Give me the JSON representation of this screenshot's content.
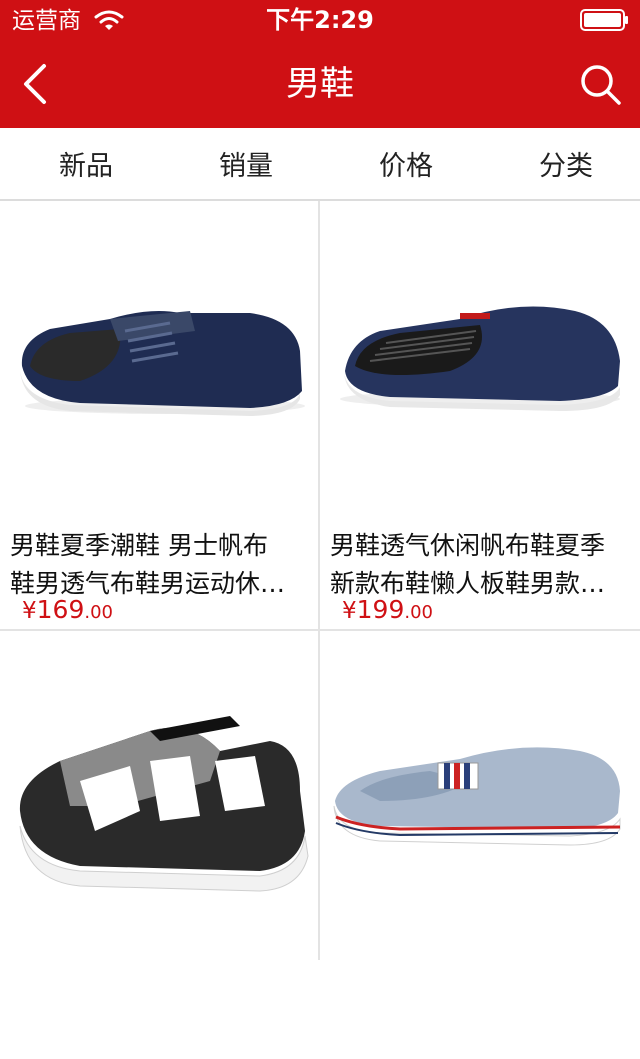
{
  "status_bar": {
    "carrier": "运营商",
    "time": "下午2:29",
    "wifi_icon": "wifi-icon",
    "battery_icon": "battery-icon"
  },
  "nav": {
    "title": "男鞋",
    "back_icon": "chevron-left-icon",
    "search_icon": "search-icon",
    "background": "#cf1014"
  },
  "filters": [
    "新品",
    "销量",
    "价格",
    "分类"
  ],
  "products": [
    {
      "name_line1": "男鞋夏季潮鞋 男士帆布",
      "name_line2": "鞋男透气布鞋男运动休…",
      "price_currency": "¥",
      "price_int": "169",
      "price_dec": ".00"
    },
    {
      "name_line1": "男鞋透气休闲帆布鞋夏季",
      "name_line2": "新款布鞋懒人板鞋男款…",
      "price_currency": "¥",
      "price_int": "199",
      "price_dec": ".00"
    },
    {
      "name_line1": "",
      "name_line2": "",
      "price_currency": "",
      "price_int": "",
      "price_dec": ""
    },
    {
      "name_line1": "",
      "name_line2": "",
      "price_currency": "",
      "price_int": "",
      "price_dec": ""
    }
  ],
  "colors": {
    "accent": "#cf1014",
    "price": "#cf1014"
  }
}
